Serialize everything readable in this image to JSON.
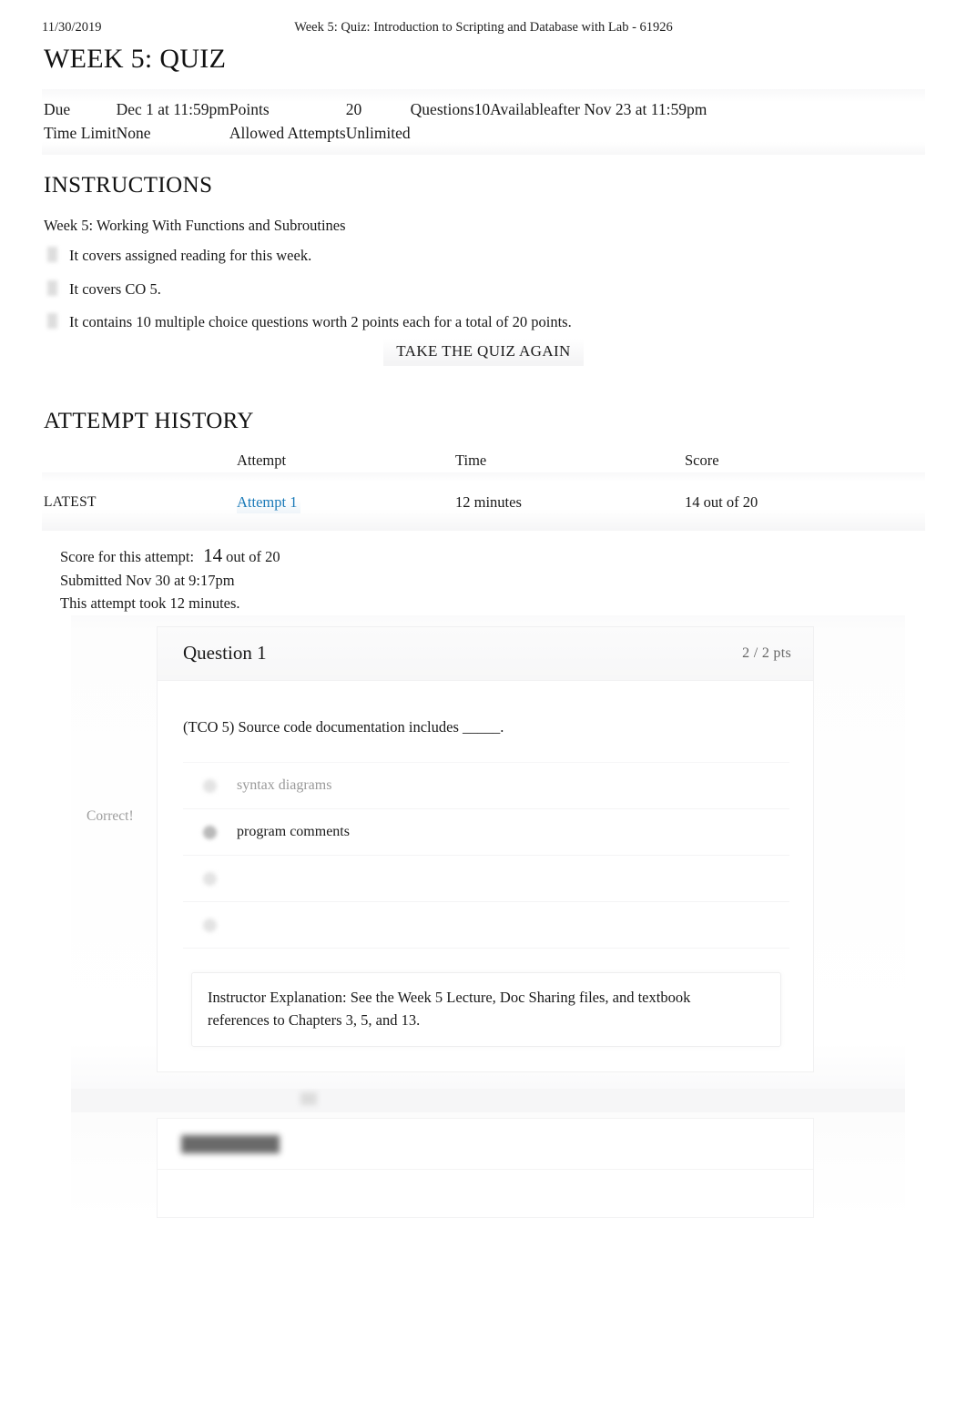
{
  "print_header": {
    "date": "11/30/2019",
    "title": "Week 5: Quiz: Introduction to Scripting and Database with Lab - 61926"
  },
  "quiz": {
    "title": "WEEK 5: QUIZ",
    "details": {
      "due_label": "Due",
      "due_value": "Dec 1 at 11:59pm",
      "points_label": "Points",
      "points_value": "20",
      "questions_label": "Questions",
      "questions_value": "10",
      "available_label": "Available",
      "available_value": "after Nov 23 at 11:59pm",
      "time_limit_label": "Time Limit",
      "time_limit_value": "None",
      "allowed_attempts_label": "Allowed Attempts",
      "allowed_attempts_value": "Unlimited"
    }
  },
  "instructions": {
    "heading": "INSTRUCTIONS",
    "lead": "Week 5: Working With Functions and Subroutines",
    "items": [
      "It covers assigned reading for this week.",
      "It covers CO 5.",
      "It contains 10 multiple choice questions worth 2 points each for a total of 20 points."
    ],
    "take_again_label": "TAKE THE QUIZ AGAIN"
  },
  "attempt_history": {
    "heading": "ATTEMPT HISTORY",
    "columns": {
      "kept": "",
      "attempt": "Attempt",
      "time": "Time",
      "score": "Score"
    },
    "rows": [
      {
        "kept": "LATEST",
        "attempt": "Attempt 1",
        "time": "12 minutes",
        "score": "14 out of 20"
      }
    ]
  },
  "attempt_summary": {
    "score_label": "Score for this attempt:",
    "score_value": "14",
    "score_suffix": "out of 20",
    "submitted": "Submitted Nov 30 at 9:17pm",
    "duration": "This attempt took 12 minutes."
  },
  "question_1": {
    "name": "Question 1",
    "points": "2 / 2 pts",
    "text": "(TCO 5) Source code documentation includes _____.",
    "correct_flag": "Correct!",
    "answers": [
      {
        "label": "syntax diagrams",
        "selected": false,
        "hidden": false
      },
      {
        "label": "program comments",
        "selected": true,
        "hidden": false
      },
      {
        "label": "",
        "selected": false,
        "hidden": true
      },
      {
        "label": "",
        "selected": false,
        "hidden": true
      }
    ],
    "explanation": "Instructor Explanation: See the Week 5 Lecture, Doc Sharing files, and textbook references to Chapters 3, 5, and 13."
  },
  "question_2": {
    "name": ""
  },
  "colors": {
    "link": "#1a7ab8",
    "text": "#1a1a1a",
    "muted": "#9a9a9a",
    "panel_bg": "#f7f7f8"
  }
}
